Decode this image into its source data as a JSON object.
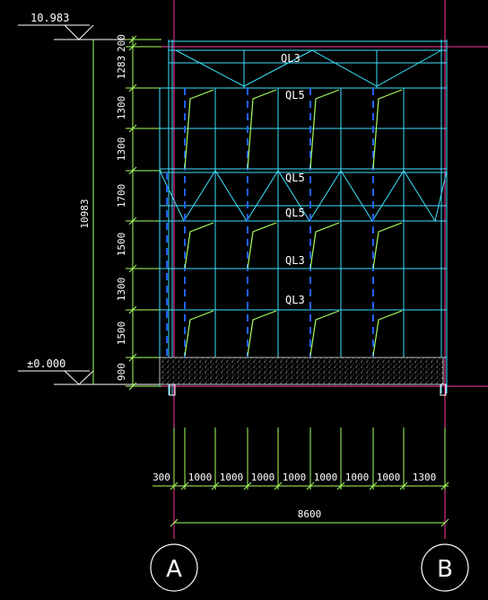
{
  "elevations": {
    "top": "10.983",
    "ground": "±0.000"
  },
  "vertical_dims": [
    "200",
    "1283",
    "1300",
    "1300",
    "1700",
    "1500",
    "1300",
    "1500",
    "900"
  ],
  "total_height": "10983",
  "beam_labels": [
    "QL3",
    "QL5",
    "QL5",
    "QL5",
    "QL3",
    "QL3"
  ],
  "horizontal_dims": [
    "300",
    "1000",
    "1000",
    "1000",
    "1000",
    "1000",
    "1000",
    "1000",
    "1300"
  ],
  "total_width": "8600",
  "axes": [
    "A",
    "B"
  ],
  "colors": {
    "grid": "#3ee0ff",
    "dim": "#a8ff60",
    "column": "#2060ff",
    "axisline": "#ff3aa0",
    "base": "#e0e0e0",
    "text": "#ffffff"
  }
}
